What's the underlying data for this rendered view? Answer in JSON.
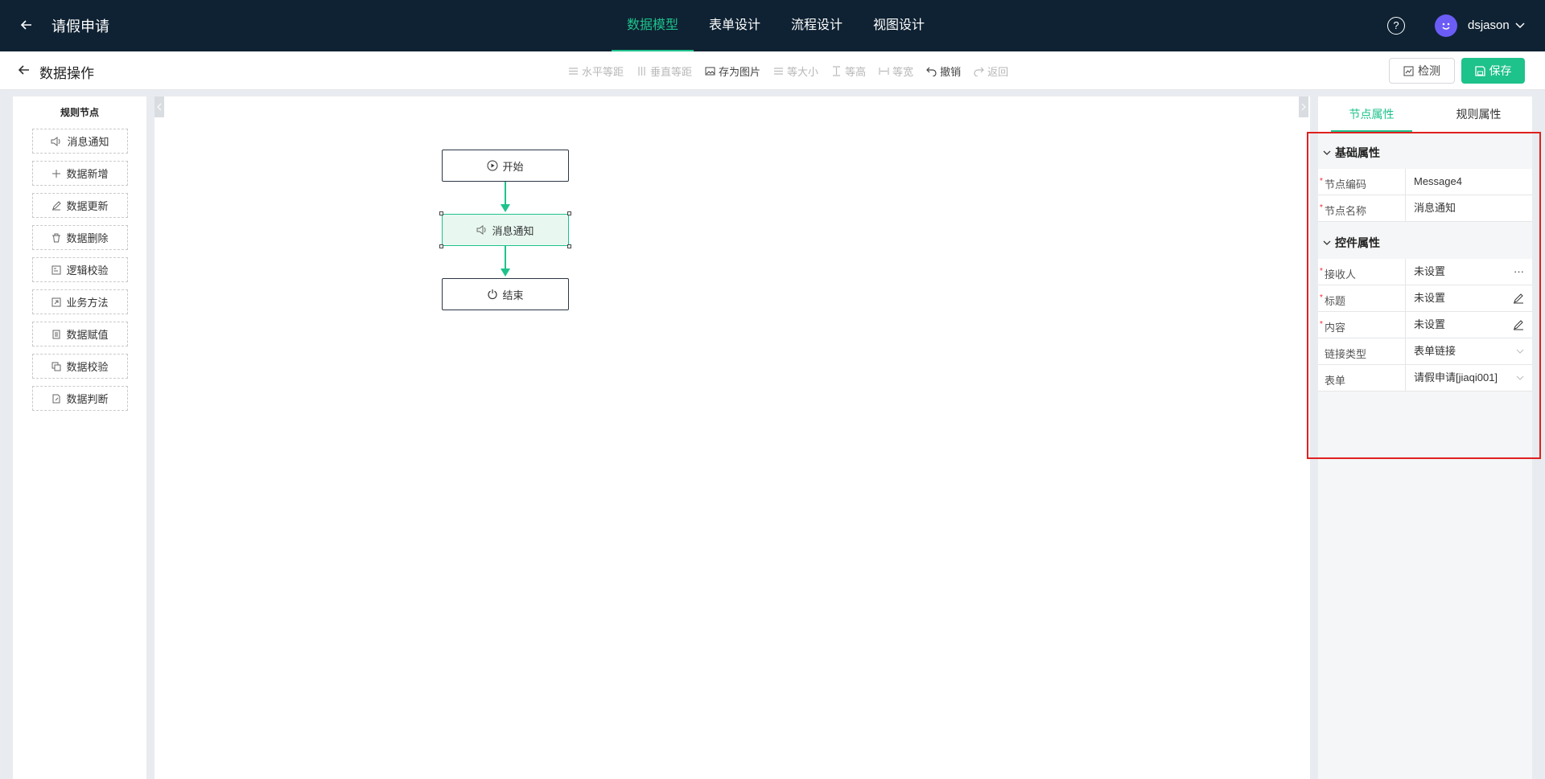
{
  "header": {
    "app_title": "请假申请",
    "nav_tabs": [
      {
        "label": "数据模型",
        "active": true
      },
      {
        "label": "表单设计",
        "active": false
      },
      {
        "label": "流程设计",
        "active": false
      },
      {
        "label": "视图设计",
        "active": false
      }
    ],
    "help_icon": "question-circle-icon",
    "username": "dsjason"
  },
  "subbar": {
    "title": "数据操作",
    "toolbar": [
      {
        "label": "水平等距",
        "icon": "align-horizontal-icon",
        "enabled": false
      },
      {
        "label": "垂直等距",
        "icon": "align-vertical-icon",
        "enabled": false
      },
      {
        "label": "存为图片",
        "icon": "image-icon",
        "enabled": true
      },
      {
        "label": "等大小",
        "icon": "same-size-icon",
        "enabled": false
      },
      {
        "label": "等高",
        "icon": "same-height-icon",
        "enabled": false
      },
      {
        "label": "等宽",
        "icon": "same-width-icon",
        "enabled": false
      },
      {
        "label": "撤销",
        "icon": "undo-icon",
        "enabled": true
      },
      {
        "label": "返回",
        "icon": "redo-icon",
        "enabled": false
      }
    ],
    "check_label": "检测",
    "save_label": "保存"
  },
  "left_panel": {
    "title": "规则节点",
    "nodes": [
      {
        "label": "消息通知",
        "icon": "speaker-icon"
      },
      {
        "label": "数据新增",
        "icon": "plus-icon"
      },
      {
        "label": "数据更新",
        "icon": "edit-icon"
      },
      {
        "label": "数据删除",
        "icon": "trash-icon"
      },
      {
        "label": "逻辑校验",
        "icon": "logic-icon"
      },
      {
        "label": "业务方法",
        "icon": "method-icon"
      },
      {
        "label": "数据赋值",
        "icon": "assign-icon"
      },
      {
        "label": "数据校验",
        "icon": "copy-check-icon"
      },
      {
        "label": "数据判断",
        "icon": "file-judge-icon"
      }
    ]
  },
  "canvas": {
    "nodes": [
      {
        "label": "开始",
        "icon": "play-circle-icon"
      },
      {
        "label": "消息通知",
        "icon": "speaker-icon",
        "selected": true
      },
      {
        "label": "结束",
        "icon": "power-icon"
      }
    ]
  },
  "right_panel": {
    "tabs": [
      {
        "label": "节点属性",
        "active": true
      },
      {
        "label": "规则属性",
        "active": false
      }
    ],
    "basic_section": {
      "title": "基础属性",
      "rows": [
        {
          "label": "节点编码",
          "value": "Message4",
          "required": true
        },
        {
          "label": "节点名称",
          "value": "消息通知",
          "required": true
        }
      ]
    },
    "control_section": {
      "title": "控件属性",
      "rows": [
        {
          "label": "接收人",
          "value": "未设置",
          "required": true,
          "suffix": "···"
        },
        {
          "label": "标题",
          "value": "未设置",
          "required": true,
          "suffix_icon": "edit-icon"
        },
        {
          "label": "内容",
          "value": "未设置",
          "required": true,
          "suffix_icon": "edit-icon"
        },
        {
          "label": "链接类型",
          "value": "表单链接",
          "required": false,
          "suffix_icon": "chevron-down-icon"
        },
        {
          "label": "表单",
          "value": "请假申请[jiaqi001]",
          "required": false,
          "suffix_icon": "chevron-down-icon"
        }
      ]
    }
  },
  "colors": {
    "accent": "#1ec28b",
    "header_bg": "#0f2233",
    "highlight": "#e02020"
  }
}
